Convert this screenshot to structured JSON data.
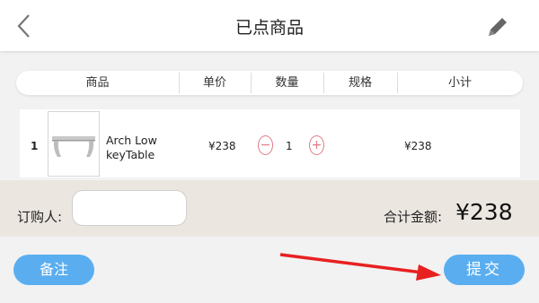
{
  "header": {
    "title": "已点商品"
  },
  "table": {
    "columns": [
      "商品",
      "单价",
      "数量",
      "规格",
      "小计"
    ],
    "rows": [
      {
        "index": "1",
        "name_line1": "Arch Low",
        "name_line2": "keyTable",
        "price": "¥238",
        "quantity": "1",
        "spec": "",
        "subtotal": "¥238"
      }
    ]
  },
  "footer": {
    "buyer_label": "订购人:",
    "buyer_value": "",
    "total_label": "合计金额:",
    "total_amount": "¥238"
  },
  "actions": {
    "note_label": "备注",
    "submit_label": "提交"
  },
  "colors": {
    "accent": "#5aaef0",
    "stepper": "#e07a86",
    "annotation_arrow": "#e82020"
  }
}
